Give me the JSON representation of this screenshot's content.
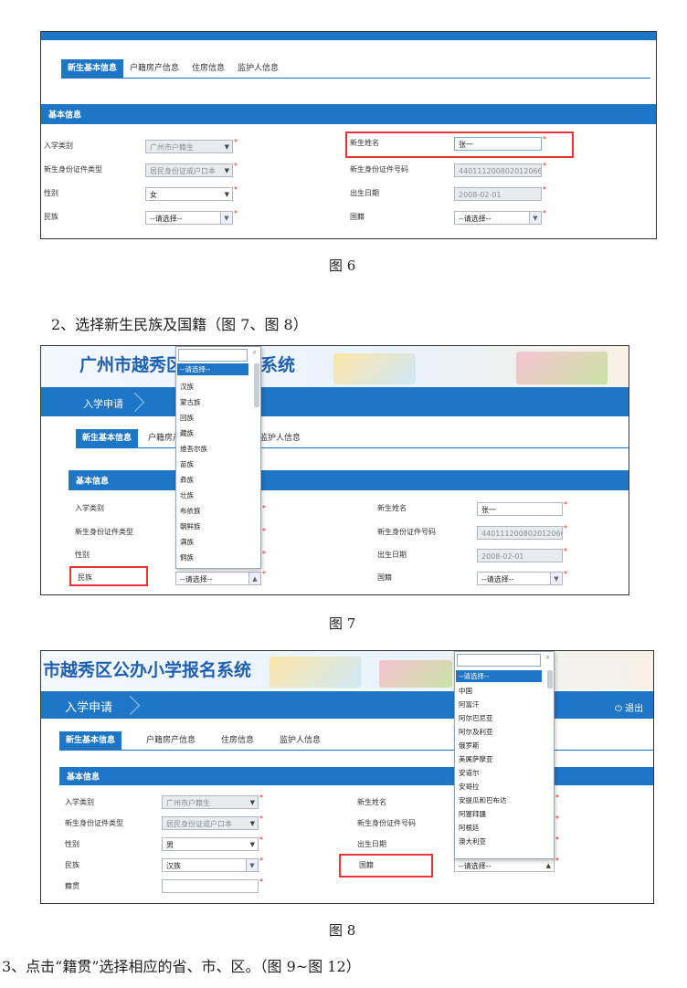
{
  "tabs": [
    "新生基本信息",
    "户籍房产信息",
    "住房信息",
    "监护人信息"
  ],
  "section_title": "基本信息",
  "labels": {
    "entry_type": "入学类别",
    "id_type": "新生身份证件类型",
    "gender": "性别",
    "ethnicity": "民族",
    "name": "新生姓名",
    "id_number": "新生身份证件号码",
    "birth_date": "出生日期",
    "nationality": "国籍",
    "native_place": "籍贯"
  },
  "fig6": {
    "entry_type": "广州市户籍生",
    "id_type": "居民身份证或户口本",
    "gender": "女",
    "ethnicity": "--请选择--",
    "name": "张一",
    "id_number": "440111200802012066",
    "birth_date": "2008-02-01",
    "nationality": "--请选择--",
    "caption": "图 6"
  },
  "step2": "2、选择新生民族及国籍（图 7、图 8）",
  "fig7": {
    "banner_title_left": "广州市越秀区",
    "banner_title_right": "系统",
    "nav_item": "入学申请",
    "tab_partial": "户籍房产",
    "tab_partial2": "监护人信息",
    "ethnicity": "--请选择--",
    "name": "张一",
    "id_number": "440111200802012066",
    "birth_date": "2008-02-01",
    "nationality": "--请选择--",
    "dropdown_selected": "--请选择--",
    "dropdown_items": [
      "汉族",
      "蒙古族",
      "回族",
      "藏族",
      "维吾尔族",
      "苗族",
      "彝族",
      "壮族",
      "布依族",
      "朝鲜族",
      "满族",
      "侗族"
    ],
    "caption": "图 7"
  },
  "fig8": {
    "banner_title": "市越秀区公办小学报名系统",
    "nav_item": "入学申请",
    "logout": "退出",
    "entry_type": "广州市户籍生",
    "id_type": "居民身份证或户口本",
    "gender": "男",
    "ethnicity": "汉族",
    "native_place": "",
    "nationality": "--请选择--",
    "dropdown_selected": "--请选择--",
    "dropdown_items": [
      "中国",
      "阿富汗",
      "阿尔巴尼亚",
      "阿尔及利亚",
      "俄罗斯",
      "美属萨摩亚",
      "安道尔",
      "安哥拉",
      "安提瓜和巴布达",
      "阿塞拜疆",
      "阿根廷",
      "澳大利亚"
    ],
    "caption": "图 8"
  },
  "step3": "3、点击“籍贯”选择相应的省、市、区。（图 9~图 12）",
  "colors": {
    "primary": "#1e76c6",
    "highlight": "#e33333"
  }
}
